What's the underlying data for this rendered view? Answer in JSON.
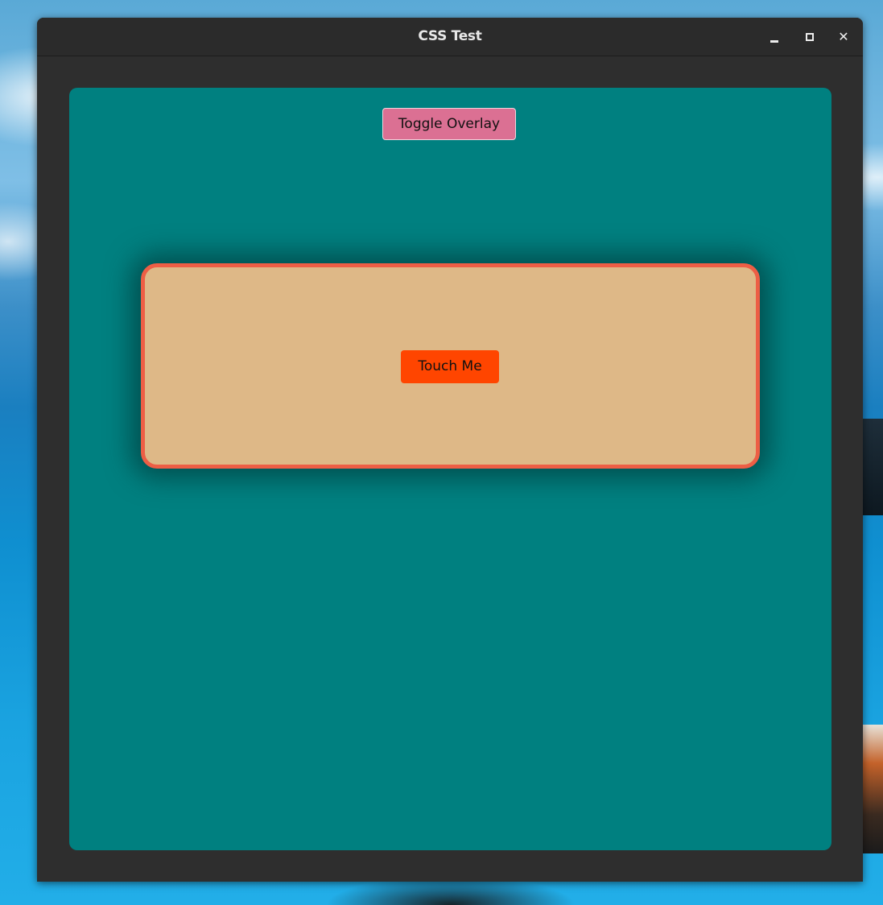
{
  "window": {
    "title": "CSS Test",
    "controls": {
      "minimize_icon": "minimize-icon",
      "maximize_icon": "maximize-icon",
      "close_icon": "close-icon",
      "close_glyph": "✕"
    }
  },
  "toolbar": {
    "toggle_label": "Toggle Overlay"
  },
  "overlay": {
    "button_label": "Touch Me"
  },
  "colors": {
    "content_bg": "#008080",
    "toggle_bg": "#db7093",
    "overlay_bg": "#deb887",
    "overlay_border": "#ed5e45",
    "touch_bg": "#ff4500",
    "titlebar_bg": "#2b2b2b"
  }
}
